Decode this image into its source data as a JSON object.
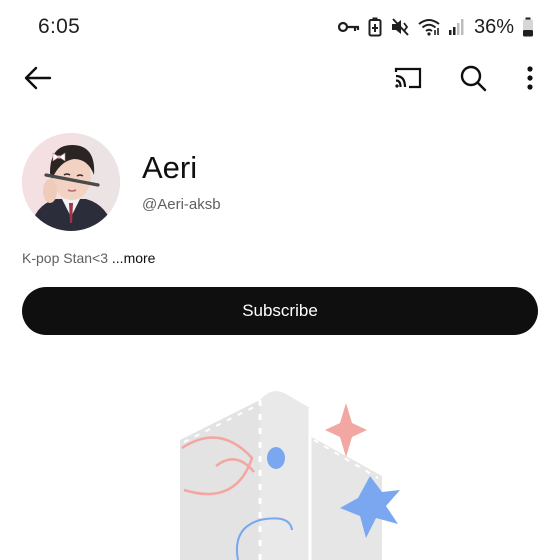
{
  "status_bar": {
    "time": "6:05",
    "battery": "36%",
    "icons": [
      "key-icon",
      "data-saver-icon",
      "vibrate-mute-icon",
      "wifi-icon",
      "signal-icon",
      "battery-icon"
    ]
  },
  "app_bar": {
    "icons": [
      "back-arrow-icon",
      "cast-icon",
      "search-icon",
      "more-vert-icon"
    ]
  },
  "channel": {
    "name": "Aeri",
    "handle": "@Aeri-aksb",
    "description": "K-pop Stan<3 ",
    "more_label": "...more"
  },
  "subscribe": {
    "label": "Subscribe"
  },
  "colors": {
    "text_primary": "#0f0f0f",
    "text_secondary": "#606060",
    "subscribe_bg": "#0f0f0f",
    "illustration_gray": "#e3e3e3",
    "illustration_pink": "#f3a7a3",
    "illustration_blue": "#7aa7ef"
  }
}
